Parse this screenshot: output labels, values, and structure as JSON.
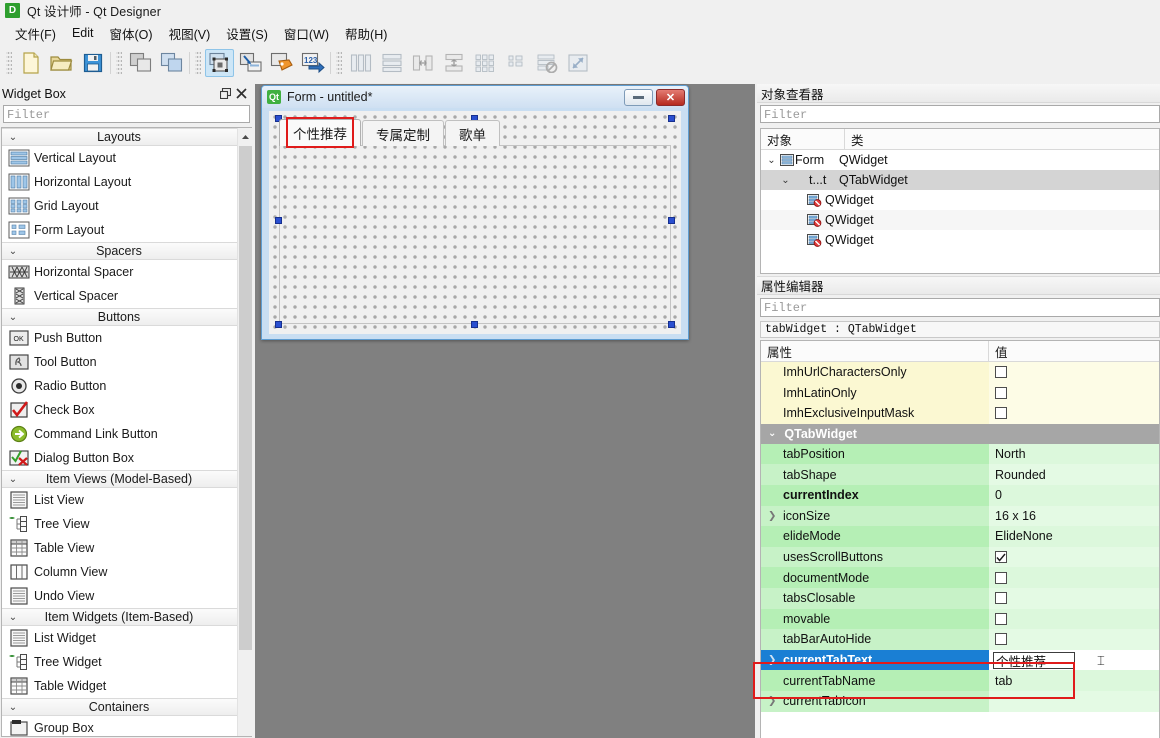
{
  "window": {
    "title": "Qt 设计师 - Qt Designer",
    "app_icon": "D"
  },
  "menubar": {
    "items": [
      {
        "label": "文件(F)",
        "name": "menu-file"
      },
      {
        "label": "Edit",
        "name": "menu-edit"
      },
      {
        "label": "窗体(O)",
        "name": "menu-form"
      },
      {
        "label": "视图(V)",
        "name": "menu-view"
      },
      {
        "label": "设置(S)",
        "name": "menu-settings"
      },
      {
        "label": "窗口(W)",
        "name": "menu-window"
      },
      {
        "label": "帮助(H)",
        "name": "menu-help"
      }
    ]
  },
  "toolbar": {
    "groups": [
      {
        "buttons": [
          {
            "name": "new-form-icon",
            "icon": "new",
            "state": "enabled"
          },
          {
            "name": "open-form-icon",
            "icon": "open",
            "state": "enabled"
          },
          {
            "name": "save-form-icon",
            "icon": "save",
            "state": "enabled"
          }
        ]
      },
      {
        "buttons": [
          {
            "name": "undo-icon",
            "icon": "copy-gray",
            "state": "enabled"
          },
          {
            "name": "redo-icon",
            "icon": "copy-blue",
            "state": "enabled"
          }
        ]
      },
      {
        "buttons": [
          {
            "name": "edit-widgets-icon",
            "icon": "edit-widgets",
            "state": "active"
          },
          {
            "name": "edit-signals-slots-icon",
            "icon": "signals-slots",
            "state": "enabled"
          },
          {
            "name": "edit-buddies-icon",
            "icon": "buddies",
            "state": "enabled"
          },
          {
            "name": "edit-tab-order-icon",
            "icon": "tab-order",
            "state": "enabled"
          }
        ]
      },
      {
        "buttons": [
          {
            "name": "layout-horizontally-icon",
            "icon": "lay-h",
            "state": "disabled"
          },
          {
            "name": "layout-vertically-icon",
            "icon": "lay-v",
            "state": "disabled"
          },
          {
            "name": "layout-splitter-h-icon",
            "icon": "split-h",
            "state": "disabled"
          },
          {
            "name": "layout-splitter-v-icon",
            "icon": "split-v",
            "state": "disabled"
          },
          {
            "name": "layout-grid-icon",
            "icon": "lay-grid",
            "state": "disabled"
          },
          {
            "name": "layout-form-icon",
            "icon": "lay-form",
            "state": "disabled"
          },
          {
            "name": "break-layout-icon",
            "icon": "break-layout",
            "state": "disabled"
          },
          {
            "name": "adjust-size-icon",
            "icon": "adjust-size",
            "state": "disabled"
          }
        ]
      }
    ]
  },
  "widget_box": {
    "title": "Widget Box",
    "filter_placeholder": "Filter",
    "filter_value": "",
    "sections": [
      {
        "title": "Layouts",
        "items": [
          {
            "label": "Vertical Layout",
            "icon": "vertical-layout-icon"
          },
          {
            "label": "Horizontal Layout",
            "icon": "horizontal-layout-icon"
          },
          {
            "label": "Grid Layout",
            "icon": "grid-layout-icon"
          },
          {
            "label": "Form Layout",
            "icon": "form-layout-icon"
          }
        ]
      },
      {
        "title": "Spacers",
        "items": [
          {
            "label": "Horizontal Spacer",
            "icon": "horizontal-spacer-icon"
          },
          {
            "label": "Vertical Spacer",
            "icon": "vertical-spacer-icon"
          }
        ]
      },
      {
        "title": "Buttons",
        "items": [
          {
            "label": "Push Button",
            "icon": "push-button-icon"
          },
          {
            "label": "Tool Button",
            "icon": "tool-button-icon"
          },
          {
            "label": "Radio Button",
            "icon": "radio-button-icon"
          },
          {
            "label": "Check Box",
            "icon": "check-box-icon"
          },
          {
            "label": "Command Link Button",
            "icon": "command-link-button-icon"
          },
          {
            "label": "Dialog Button Box",
            "icon": "dialog-button-box-icon"
          }
        ]
      },
      {
        "title": "Item Views (Model-Based)",
        "items": [
          {
            "label": "List View",
            "icon": "list-view-icon"
          },
          {
            "label": "Tree View",
            "icon": "tree-view-icon"
          },
          {
            "label": "Table View",
            "icon": "table-view-icon"
          },
          {
            "label": "Column View",
            "icon": "column-view-icon"
          },
          {
            "label": "Undo View",
            "icon": "undo-view-icon"
          }
        ]
      },
      {
        "title": "Item Widgets (Item-Based)",
        "items": [
          {
            "label": "List Widget",
            "icon": "list-widget-icon"
          },
          {
            "label": "Tree Widget",
            "icon": "tree-widget-icon"
          },
          {
            "label": "Table Widget",
            "icon": "table-widget-icon"
          }
        ]
      },
      {
        "title": "Containers",
        "items": [
          {
            "label": "Group Box",
            "icon": "group-box-icon"
          }
        ]
      }
    ]
  },
  "form_window": {
    "title": "Form - untitled*",
    "icon_label": "Qt",
    "minimize_label": "",
    "close_label": "✕",
    "tabs": [
      {
        "label": "个性推荐",
        "selected": true
      },
      {
        "label": "专属定制",
        "selected": false
      },
      {
        "label": "歌单",
        "selected": false
      }
    ]
  },
  "object_inspector": {
    "title": "对象查看器",
    "filter_placeholder": "Filter",
    "filter_value": "",
    "columns": {
      "object": "对象",
      "class": "类"
    },
    "rows": [
      {
        "name": "Form",
        "class": "QWidget",
        "indent": 0,
        "chevron": "⌄",
        "icon": "widget-icon",
        "selected": false
      },
      {
        "name": "t...t",
        "class": "QTabWidget",
        "indent": 1,
        "chevron": "⌄",
        "icon": "",
        "selected": true
      },
      {
        "name": "",
        "class": "QWidget",
        "indent": 2,
        "chevron": "",
        "icon": "page-icon",
        "selected": false
      },
      {
        "name": "",
        "class": "QWidget",
        "indent": 2,
        "chevron": "",
        "icon": "page-icon",
        "selected": false
      },
      {
        "name": "",
        "class": "QWidget",
        "indent": 2,
        "chevron": "",
        "icon": "page-icon",
        "selected": false
      }
    ]
  },
  "property_editor": {
    "title": "属性编辑器",
    "filter_placeholder": "Filter",
    "filter_value": "",
    "object_line": "tabWidget : QTabWidget",
    "columns": {
      "property": "属性",
      "value": "值"
    },
    "rows": [
      {
        "name": "ImhUrlCharactersOnly",
        "value": "",
        "kind": "imh",
        "type": "checkbox",
        "checked": false
      },
      {
        "name": "ImhLatinOnly",
        "value": "",
        "kind": "imh",
        "type": "checkbox",
        "checked": false
      },
      {
        "name": "ImhExclusiveInputMask",
        "value": "",
        "kind": "imh",
        "type": "checkbox",
        "checked": false
      },
      {
        "name": "QTabWidget",
        "value": "",
        "kind": "group",
        "type": "group",
        "chevron": "⌄"
      },
      {
        "name": "tabPosition",
        "value": "North",
        "kind": "green",
        "type": "text"
      },
      {
        "name": "tabShape",
        "value": "Rounded",
        "kind": "green",
        "type": "text"
      },
      {
        "name": "currentIndex",
        "value": "0",
        "kind": "green",
        "type": "text",
        "bold": true
      },
      {
        "name": "iconSize",
        "value": "16 x 16",
        "kind": "green",
        "type": "text",
        "expandable": true
      },
      {
        "name": "elideMode",
        "value": "ElideNone",
        "kind": "green",
        "type": "text"
      },
      {
        "name": "usesScrollButtons",
        "value": "",
        "kind": "green",
        "type": "checkbox",
        "checked": true
      },
      {
        "name": "documentMode",
        "value": "",
        "kind": "green",
        "type": "checkbox",
        "checked": false
      },
      {
        "name": "tabsClosable",
        "value": "",
        "kind": "green",
        "type": "checkbox",
        "checked": false
      },
      {
        "name": "movable",
        "value": "",
        "kind": "green",
        "type": "checkbox",
        "checked": false
      },
      {
        "name": "tabBarAutoHide",
        "value": "",
        "kind": "green",
        "type": "checkbox",
        "checked": false
      },
      {
        "name": "currentTabText",
        "value": "个性推荐",
        "kind": "selected",
        "type": "edit",
        "bold": true,
        "expandable": true
      },
      {
        "name": "currentTabName",
        "value": "tab",
        "kind": "green",
        "type": "text"
      },
      {
        "name": "currentTabIcon",
        "value": "",
        "kind": "green",
        "type": "text",
        "expandable": true
      }
    ]
  },
  "highlights": {
    "accent_red": "#e01b1b",
    "selection_blue": "#1a7fd4",
    "handle_blue": "#2a4fd0"
  }
}
